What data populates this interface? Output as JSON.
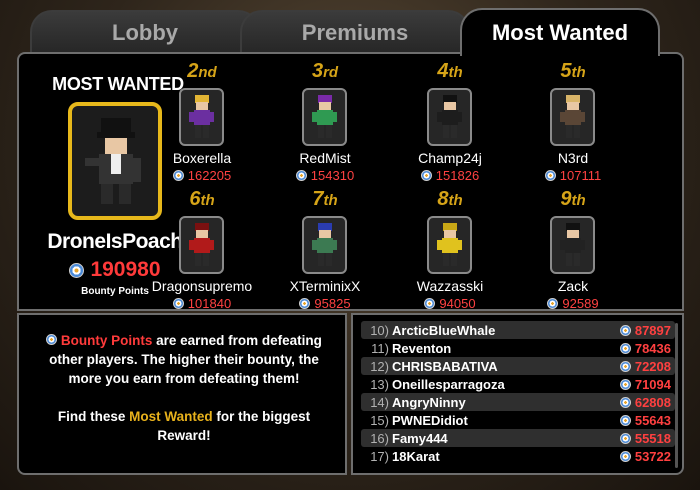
{
  "tabs": [
    {
      "label": "Lobby",
      "active": false
    },
    {
      "label": "Premiums",
      "active": false
    },
    {
      "label": "Most Wanted",
      "active": true
    }
  ],
  "leader": {
    "heading": "MOST WANTED",
    "name": "DroneIsPoach",
    "points": "190980",
    "points_label": "Bounty Points",
    "outfit_color": "#333333"
  },
  "ranks": [
    {
      "place": "2",
      "suffix": "nd",
      "name": "Boxerella",
      "points": "162205",
      "outfit_color": "#6b2fa0",
      "hair_color": "#e2b534"
    },
    {
      "place": "3",
      "suffix": "rd",
      "name": "RedMist",
      "points": "154310",
      "outfit_color": "#2f9a52",
      "hair_color": "#7a2aa8"
    },
    {
      "place": "4",
      "suffix": "th",
      "name": "Champ24j",
      "points": "151826",
      "outfit_color": "#1d1d1d",
      "hair_color": "#111111"
    },
    {
      "place": "5",
      "suffix": "th",
      "name": "N3rd",
      "points": "107111",
      "outfit_color": "#5a4636",
      "hair_color": "#d8b468"
    },
    {
      "place": "6",
      "suffix": "th",
      "name": "Dragonsupremo",
      "points": "101840",
      "outfit_color": "#b11a1a",
      "hair_color": "#7a1010"
    },
    {
      "place": "7",
      "suffix": "th",
      "name": "XTerminixX",
      "points": "95825",
      "outfit_color": "#3c7a52",
      "hair_color": "#2a3cb0"
    },
    {
      "place": "8",
      "suffix": "th",
      "name": "Wazzasski",
      "points": "94050",
      "outfit_color": "#e0c21e",
      "hair_color": "#c9a816"
    },
    {
      "place": "9",
      "suffix": "th",
      "name": "Zack",
      "points": "92589",
      "outfit_color": "#222222",
      "hair_color": "#111111"
    }
  ],
  "info": {
    "bounty_points": "Bounty Points",
    "line1": " are earned from defeating other players. The higher their bounty, the more you earn from defeating them!",
    "find_prefix": "Find these ",
    "most_wanted": "Most Wanted",
    "find_suffix": " for the biggest Reward!"
  },
  "list": [
    {
      "num": "10)",
      "name": "ArcticBlueWhale",
      "points": "87897"
    },
    {
      "num": "11)",
      "name": "Reventon",
      "points": "78436"
    },
    {
      "num": "12)",
      "name": "CHRISBABATIVA",
      "points": "72208"
    },
    {
      "num": "13)",
      "name": "Oneillesparragoza",
      "points": "71094"
    },
    {
      "num": "14)",
      "name": "AngryNinny",
      "points": "62808"
    },
    {
      "num": "15)",
      "name": "PWNEDidiot",
      "points": "55643"
    },
    {
      "num": "16)",
      "name": "Famy444",
      "points": "55518"
    },
    {
      "num": "17)",
      "name": "18Karat",
      "points": "53722"
    }
  ],
  "colors": {
    "accent_gold": "#e7b81b",
    "points_red": "#ff3a3a",
    "panel_border": "#6e6e6e"
  }
}
